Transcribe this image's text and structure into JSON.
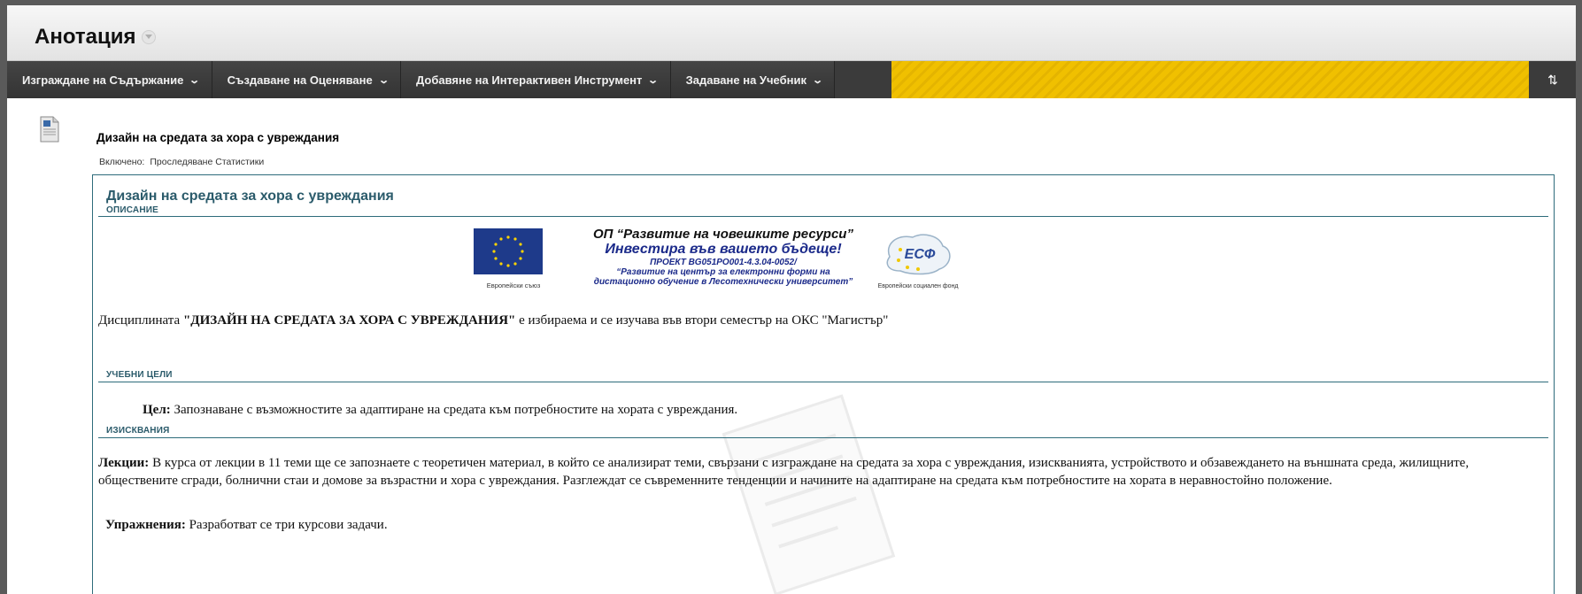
{
  "page": {
    "title": "Анотация"
  },
  "toolbar": {
    "items": [
      {
        "label": "Изграждане на Съдържание"
      },
      {
        "label": "Създаване на Оценяване"
      },
      {
        "label": "Добавяне на Интерактивен Инструмент"
      },
      {
        "label": "Задаване на Учебник"
      }
    ],
    "sort_label": "⇅"
  },
  "item": {
    "title": "Дизайн на средата за хора с увреждания",
    "enabled_label": "Включено:",
    "enabled_value": "Проследяване Статистики"
  },
  "description": {
    "title": "Дизайн на средата за хора с увреждания",
    "section_description": "ОПИСАНИЕ",
    "banner": {
      "eu_caption": "Европейски съюз",
      "op_line1": "ОП “Развитие на човешките ресурси”",
      "op_line2": "Инвестира във вашето бъдеще!",
      "op_line3": "ПРОЕКТ BG051PO001-4.3.04-0052/",
      "op_line4": "“Развитие на център за електронни форми на",
      "op_line5": "дистационно обучение в Лесотехнически университет”",
      "esf_logo_text": "ЕСФ",
      "esf_caption": "Европейски социален фонд"
    },
    "intro_prefix": "Дисциплината ",
    "intro_bold": "\"ДИЗАЙН НА СРЕДАТА ЗА ХОРА С УВРЕЖДАНИЯ\"",
    "intro_suffix": " е избираема и се изучава във втори семестър на ОКС \"Магистър\"",
    "section_goals": "УЧЕБНИ ЦЕЛИ",
    "goal_label": "Цел:",
    "goal_text": " Запознаване с възможностите за адаптиране на средата към потребностите на хората с увреждания.",
    "section_requirements": "ИЗИСКВАНИЯ",
    "lectures_label": "Лекции:",
    "lectures_text": " В курса от лекции в 11 теми ще се запознаете с теоретичен материал, в който се анализират теми, свързани с изграждане на средата за хора с увреждания, изискванията, устройството и обзавеждането на външната среда, жилищните, обществените сгради, болнични стаи и домове за възрастни и хора с увреждания. Разглеждат се съвременните тенденции и начините на адаптиране на средата към потребностите на хората в неравностойно положение.",
    "exercises_label": "Упражнения:",
    "exercises_text": " Разработват се три курсови задачи."
  },
  "colors": {
    "accent": "#2e6c7b",
    "toolbar": "#3b3b3b",
    "stripe": "#f0c000",
    "eu_blue": "#1e3a8a"
  }
}
